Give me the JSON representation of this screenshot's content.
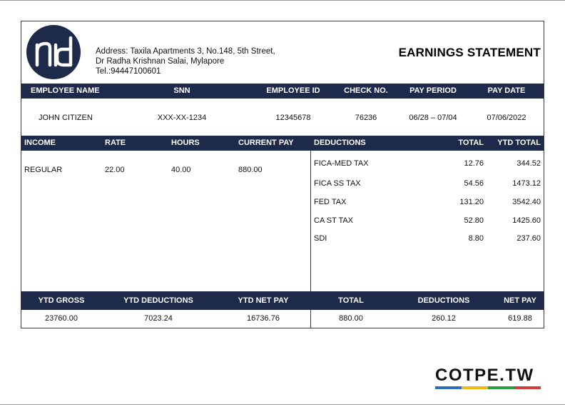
{
  "header": {
    "address_line1": "Address: Taxila Apartments 3, No.148, 5th Street,",
    "address_line2": "Dr Radha Krishnan Salai,  Mylapore",
    "address_line3": "Tel.:94447100601",
    "title": "EARNINGS STATEMENT",
    "logo_colors": {
      "circle": "#1e2a4a",
      "glyph": "#ffffff"
    }
  },
  "employee_table": {
    "headers": [
      "EMPLOYEE NAME",
      "SNN",
      "EMPLOYEE ID",
      "CHECK NO.",
      "PAY PERIOD",
      "PAY DATE"
    ],
    "values": [
      "JOHN CITIZEN",
      "XXX-XX-1234",
      "12345678",
      "76236",
      "06/28 – 07/04",
      "07/06/2022"
    ]
  },
  "income": {
    "headers": [
      "INCOME",
      "RATE",
      "HOURS",
      "CURRENT PAY"
    ],
    "rows": [
      [
        "REGULAR",
        "22.00",
        "40.00",
        "880.00"
      ]
    ]
  },
  "deductions": {
    "headers": [
      "DEDUCTIONS",
      "TOTAL",
      "YTD TOTAL"
    ],
    "rows": [
      [
        "FICA-MED TAX",
        "12.76",
        "344.52"
      ],
      [
        "FICA SS TAX",
        "54.56",
        "1473.12"
      ],
      [
        "FED TAX",
        "131.20",
        "3542.40"
      ],
      [
        "CA ST TAX",
        "52.80",
        "1425.60"
      ],
      [
        "SDI",
        "8.80",
        "237.60"
      ]
    ]
  },
  "totals": {
    "headers": [
      "YTD GROSS",
      "YTD DEDUCTIONS",
      "YTD NET PAY",
      "TOTAL",
      "DEDUCTIONS",
      "NET PAY"
    ],
    "values": [
      "23760.00",
      "7023.24",
      "16736.76",
      "880.00",
      "260.12",
      "619.88"
    ]
  },
  "brand": {
    "text": "COTPE.TW",
    "stripe_colors": [
      "#2e6fc0",
      "#f2b619",
      "#2f9e44",
      "#d63a3a"
    ]
  },
  "colors": {
    "accent": "#1e2a4a",
    "border": "#3b3b3b"
  }
}
